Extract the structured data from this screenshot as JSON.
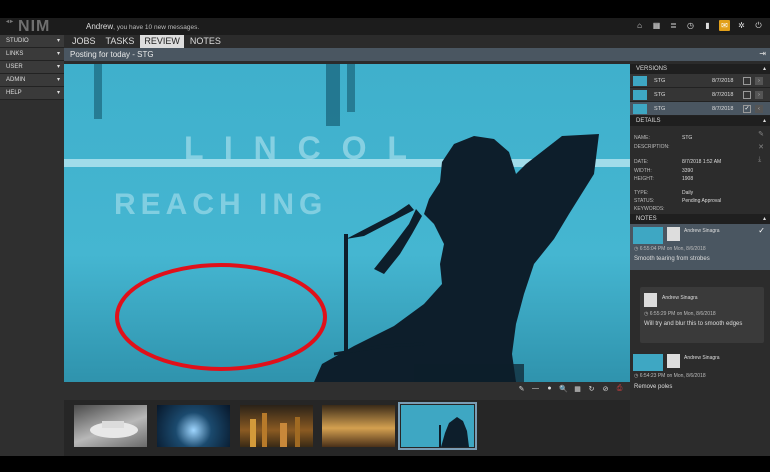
{
  "app": {
    "logo": "NIM",
    "logo_mark": "◂▸"
  },
  "header": {
    "user": "Andrew",
    "message": ", you have 10 new messages."
  },
  "header_icons": [
    "home-icon",
    "grid-icon",
    "list-icon",
    "clock-icon",
    "bookmark-icon",
    "mail-icon",
    "gear-icon",
    "power-icon"
  ],
  "sidebar": {
    "items": [
      {
        "label": "STUDIO"
      },
      {
        "label": "LINKS"
      },
      {
        "label": "USER"
      },
      {
        "label": "ADMIN"
      },
      {
        "label": "HELP"
      }
    ]
  },
  "tabs": [
    {
      "label": "JOBS"
    },
    {
      "label": "TASKS"
    },
    {
      "label": "REVIEW",
      "active": true
    },
    {
      "label": "NOTES"
    }
  ],
  "subheader": {
    "title": "Posting for today - STG"
  },
  "versions": {
    "title": "VERSIONS",
    "rows": [
      {
        "name": "STG",
        "date": "8/7/2018",
        "checked": false
      },
      {
        "name": "STG",
        "date": "8/7/2018",
        "checked": false
      },
      {
        "name": "STG",
        "date": "8/7/2018",
        "checked": true
      }
    ]
  },
  "details": {
    "title": "DETAILS",
    "fields": [
      {
        "label": "NAME:",
        "value": "STG"
      },
      {
        "label": "DESCRIPTION:",
        "value": ""
      },
      {
        "label": "DATE:",
        "value": "8/7/2018 1:52 AM"
      },
      {
        "label": "WIDTH:",
        "value": "3390"
      },
      {
        "label": "HEIGHT:",
        "value": "1908"
      },
      {
        "label": "TYPE:",
        "value": "Daily"
      },
      {
        "label": "STATUS:",
        "value": "Pending Approval"
      },
      {
        "label": "KEYWORDS:",
        "value": ""
      }
    ]
  },
  "notes": {
    "title": "NOTES",
    "items": [
      {
        "author": "Andrew Sinagra",
        "time": "◷ 6:55:04 PM on Mon, 8/6/2018",
        "text": "Smooth tearing from strobes"
      },
      {
        "author": "Andrew Sinagra",
        "time": "◷ 6:55:29 PM on Mon, 8/6/2018",
        "text": "Will try and blur this to smooth edges"
      },
      {
        "author": "Andrew Sinagra",
        "time": "◷ 6:54:23 PM on Mon, 8/6/2018",
        "text": "Remove poles"
      }
    ]
  },
  "tools": [
    "✎",
    "—",
    "●",
    "🔍",
    "▦",
    "↻",
    "⊘",
    "⎙"
  ],
  "colors": {
    "accent": "#e2a01a",
    "selection": "#4a5661",
    "annotation": "#e0101a",
    "sky": "#3ea7c3"
  }
}
